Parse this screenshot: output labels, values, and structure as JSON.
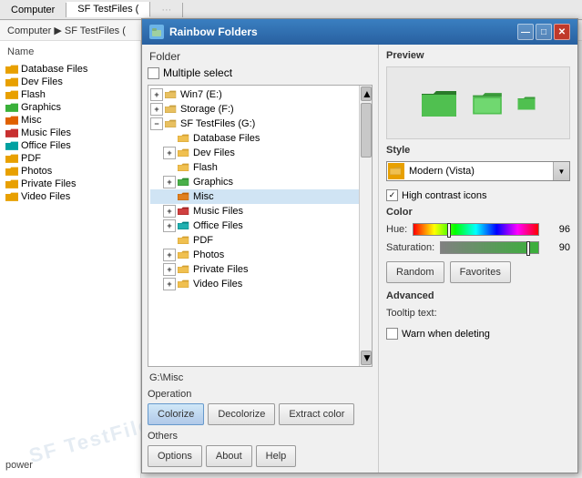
{
  "bg": {
    "tabs": [
      "Computer",
      "SF TestFiles ("
    ],
    "address": "Computer ▶ SF TestFiles (",
    "tree_header": "Name",
    "tree_items": [
      {
        "label": "Database Files",
        "color": "yellow"
      },
      {
        "label": "Dev Files",
        "color": "yellow"
      },
      {
        "label": "Flash",
        "color": "yellow"
      },
      {
        "label": "Graphics",
        "color": "green"
      },
      {
        "label": "Misc",
        "color": "orange"
      },
      {
        "label": "Music Files",
        "color": "red"
      },
      {
        "label": "Office Files",
        "color": "teal"
      },
      {
        "label": "PDF",
        "color": "yellow"
      },
      {
        "label": "Photos",
        "color": "yellow"
      },
      {
        "label": "Private Files",
        "color": "yellow"
      },
      {
        "label": "Video Files",
        "color": "yellow"
      }
    ],
    "watermark": "SF TestFiles",
    "power": "power"
  },
  "dialog": {
    "title": "Rainbow Folders",
    "title_icon": "🌈",
    "btn_minimize": "—",
    "btn_maximize": "□",
    "btn_close": "✕",
    "left": {
      "folder_header": "Folder",
      "multi_select_label": "Multiple select",
      "tree_nodes": [
        {
          "level": 1,
          "expander": "+",
          "label": "Win7 (E:)",
          "color": "plain",
          "expanded": false
        },
        {
          "level": 1,
          "expander": "+",
          "label": "Storage (F:)",
          "color": "plain",
          "expanded": false
        },
        {
          "level": 1,
          "expander": "−",
          "label": "SF TestFiles (G:)",
          "color": "plain",
          "expanded": true
        },
        {
          "level": 2,
          "expander": null,
          "label": "Database Files",
          "color": "yellow",
          "expanded": false
        },
        {
          "level": 2,
          "expander": "+",
          "label": "Dev Files",
          "color": "yellow",
          "expanded": false
        },
        {
          "level": 2,
          "expander": null,
          "label": "Flash",
          "color": "yellow",
          "expanded": false
        },
        {
          "level": 2,
          "expander": "+",
          "label": "Graphics",
          "color": "green",
          "expanded": false
        },
        {
          "level": 2,
          "expander": null,
          "label": "Misc",
          "color": "orange",
          "selected": true,
          "expanded": false
        },
        {
          "level": 2,
          "expander": "+",
          "label": "Music Files",
          "color": "red",
          "expanded": false
        },
        {
          "level": 2,
          "expander": "+",
          "label": "Office Files",
          "color": "teal",
          "expanded": false
        },
        {
          "level": 2,
          "expander": null,
          "label": "PDF",
          "color": "yellow",
          "expanded": false
        },
        {
          "level": 2,
          "expander": "+",
          "label": "Photos",
          "color": "yellow",
          "expanded": false
        },
        {
          "level": 2,
          "expander": "+",
          "label": "Private Files",
          "color": "yellow",
          "expanded": false
        },
        {
          "level": 2,
          "expander": "+",
          "label": "Video Files",
          "color": "yellow",
          "expanded": false
        }
      ],
      "path": "G:\\Misc",
      "operation_label": "Operation",
      "btn_colorize": "Colorize",
      "btn_decolorize": "Decolorize",
      "btn_extract": "Extract color",
      "others_label": "Others",
      "btn_options": "Options",
      "btn_about": "About",
      "btn_help": "Help"
    },
    "right": {
      "preview_label": "Preview",
      "style_label": "Style",
      "style_value": "Modern (Vista)",
      "hc_label": "High contrast icons",
      "color_label": "Color",
      "hue_label": "Hue:",
      "hue_value": "96",
      "hue_percent": 27,
      "sat_label": "Saturation:",
      "sat_value": "90",
      "sat_percent": 88,
      "btn_random": "Random",
      "btn_favorites": "Favorites",
      "advanced_label": "Advanced",
      "tooltip_label": "Tooltip text:",
      "warn_label": "Warn when deleting"
    }
  }
}
